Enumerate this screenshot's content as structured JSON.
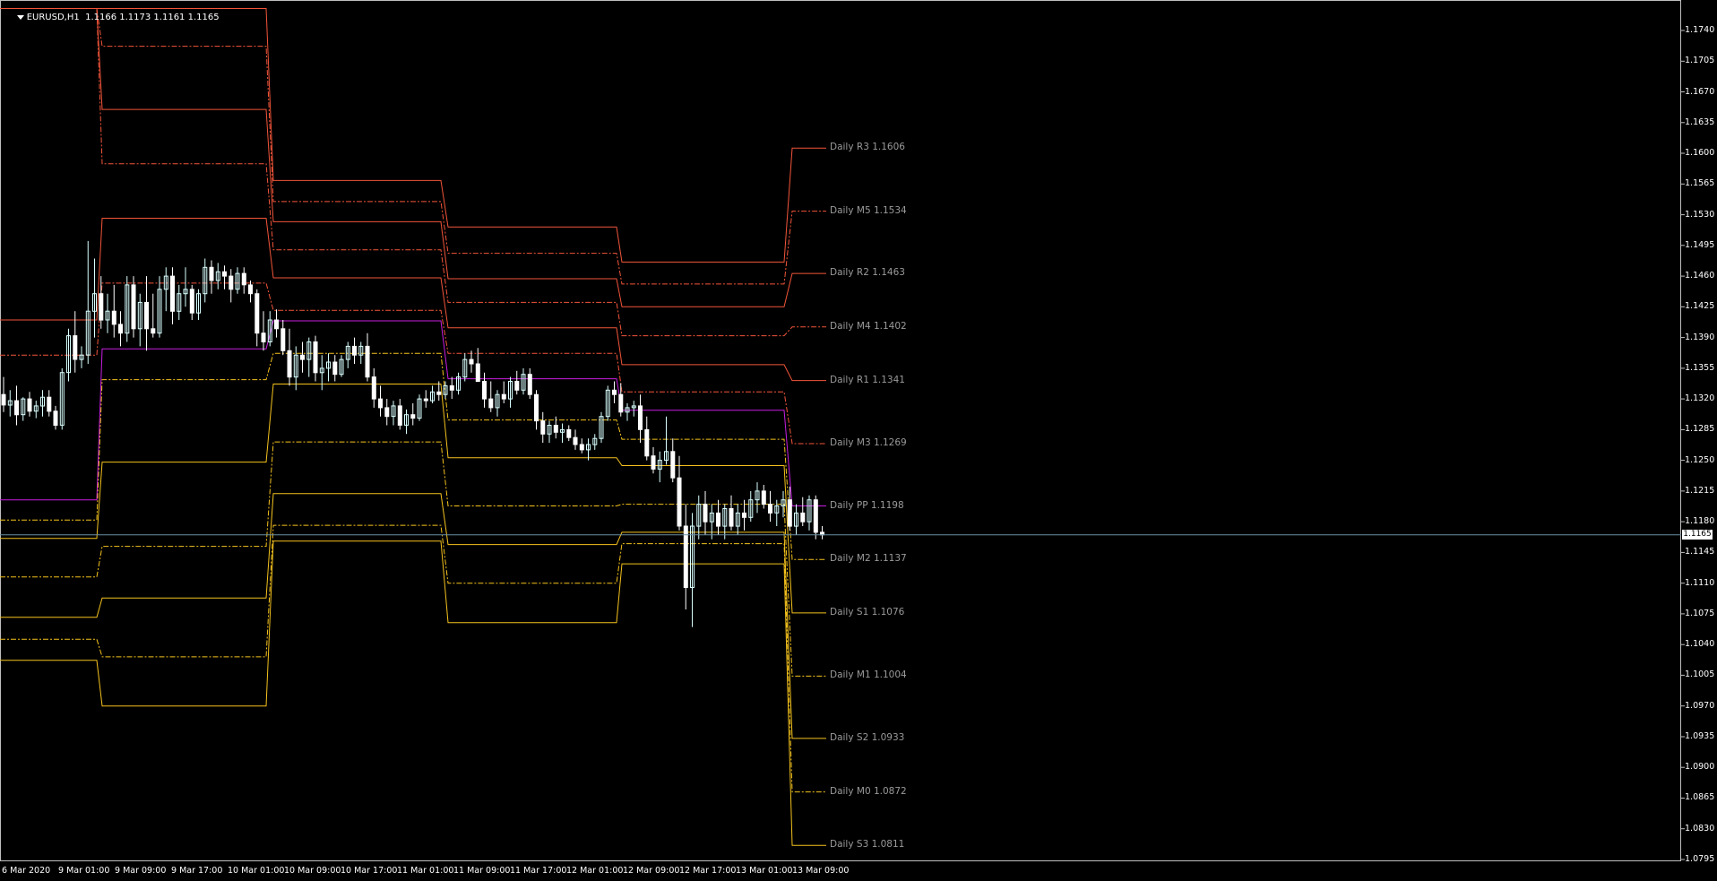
{
  "header": {
    "symbol": "EURUSD,H1",
    "ohlc": "1.1166 1.1173 1.1161 1.1165"
  },
  "current_price": "1.1165",
  "colors": {
    "background": "#000000",
    "resistance": "#f2553a",
    "support": "#f4c21d",
    "pivot": "#c81ee0",
    "candle_up": "#d9ffff",
    "candle_down": "#ffffff",
    "price_line": "#6b8fa3",
    "label": "#9a9a9a"
  },
  "y_ticks": [
    "1.1740",
    "1.1705",
    "1.1670",
    "1.1635",
    "1.1600",
    "1.1565",
    "1.1530",
    "1.1495",
    "1.1460",
    "1.1425",
    "1.1390",
    "1.1355",
    "1.1320",
    "1.1285",
    "1.1250",
    "1.1215",
    "1.1180",
    "1.1145",
    "1.1110",
    "1.1075",
    "1.1040",
    "1.1005",
    "1.0970",
    "1.0935",
    "1.0900",
    "1.0865",
    "1.0830",
    "1.0795"
  ],
  "x_ticks": [
    "6 Mar 2020",
    "9 Mar 01:00",
    "9 Mar 09:00",
    "9 Mar 17:00",
    "10 Mar 01:00",
    "10 Mar 09:00",
    "10 Mar 17:00",
    "11 Mar 01:00",
    "11 Mar 09:00",
    "11 Mar 17:00",
    "12 Mar 01:00",
    "12 Mar 09:00",
    "12 Mar 17:00",
    "13 Mar 01:00",
    "13 Mar 09:00"
  ],
  "chart_data": {
    "type": "candlestick",
    "title": "EURUSD,H1",
    "ylim": [
      1.0795,
      1.1765
    ],
    "pivot_levels": [
      {
        "name": "R3",
        "label": "Daily R3 1.1606",
        "kind": "resistance",
        "style": "solid",
        "values": [
          1.1765,
          1.1765,
          1.1569,
          1.1516,
          1.1476,
          1.1606
        ]
      },
      {
        "name": "M5",
        "label": "Daily M5 1.1534",
        "kind": "resistance",
        "style": "dashed",
        "values": [
          1.1765,
          1.1722,
          1.1545,
          1.1486,
          1.1451,
          1.1534
        ]
      },
      {
        "name": "R2",
        "label": "Daily R2 1.1463",
        "kind": "resistance",
        "style": "solid",
        "values": [
          1.1765,
          1.165,
          1.1522,
          1.1457,
          1.1425,
          1.1463
        ]
      },
      {
        "name": "M4",
        "label": "Daily M4 1.1402",
        "kind": "resistance",
        "style": "dashed",
        "values": [
          1.1765,
          1.1588,
          1.149,
          1.143,
          1.1392,
          1.1402
        ]
      },
      {
        "name": "R1",
        "label": "Daily R1 1.1341",
        "kind": "resistance",
        "style": "solid",
        "values": [
          1.141,
          1.1526,
          1.1458,
          1.1401,
          1.1359,
          1.1341
        ]
      },
      {
        "name": "M3",
        "label": "Daily M3 1.1269",
        "kind": "resistance",
        "style": "dashed",
        "values": [
          1.137,
          1.1452,
          1.1421,
          1.1372,
          1.1328,
          1.1269
        ]
      },
      {
        "name": "PP",
        "label": "Daily PP 1.1198",
        "kind": "pivot",
        "style": "solid",
        "values": [
          1.1205,
          1.1377,
          1.1409,
          1.1343,
          1.1307,
          1.1198
        ]
      },
      {
        "name": "M2",
        "label": "Daily M2 1.1137",
        "kind": "support",
        "style": "dashed",
        "values": [
          1.1182,
          1.1342,
          1.1372,
          1.1296,
          1.1274,
          1.1137
        ]
      },
      {
        "name": "S1",
        "label": "Daily S1 1.1076",
        "kind": "support",
        "style": "solid",
        "values": [
          1.1161,
          1.1248,
          1.1337,
          1.1253,
          1.1244,
          1.1076
        ]
      },
      {
        "name": "M1",
        "label": "Daily M1 1.1004",
        "kind": "support",
        "style": "dashed",
        "values": [
          1.1117,
          1.1152,
          1.1271,
          1.1198,
          1.12,
          1.1004
        ]
      },
      {
        "name": "S2",
        "label": "Daily S2 1.0933",
        "kind": "support",
        "style": "solid",
        "values": [
          1.1071,
          1.1093,
          1.1212,
          1.1154,
          1.1168,
          1.0933
        ]
      },
      {
        "name": "M0",
        "label": "Daily M0 1.0872",
        "kind": "support",
        "style": "dashed",
        "values": [
          1.1046,
          1.1026,
          1.1176,
          1.111,
          1.1155,
          1.0872
        ]
      },
      {
        "name": "S3",
        "label": "Daily S3 1.0811",
        "kind": "support",
        "style": "solid",
        "values": [
          1.1022,
          1.097,
          1.1158,
          1.1065,
          1.1132,
          1.0811
        ]
      }
    ],
    "candles": [
      [
        1.1325,
        1.1345,
        1.1305,
        1.1313
      ],
      [
        1.1313,
        1.133,
        1.13,
        1.1318
      ],
      [
        1.1318,
        1.1335,
        1.129,
        1.1302
      ],
      [
        1.1302,
        1.1322,
        1.1295,
        1.132
      ],
      [
        1.132,
        1.1328,
        1.13,
        1.1306
      ],
      [
        1.1306,
        1.1318,
        1.1298,
        1.1312
      ],
      [
        1.1312,
        1.133,
        1.13,
        1.1322
      ],
      [
        1.1322,
        1.133,
        1.13,
        1.1306
      ],
      [
        1.1306,
        1.1312,
        1.1285,
        1.129
      ],
      [
        1.129,
        1.1355,
        1.1285,
        1.135
      ],
      [
        1.135,
        1.14,
        1.134,
        1.1392
      ],
      [
        1.1392,
        1.142,
        1.135,
        1.1365
      ],
      [
        1.1365,
        1.138,
        1.1355,
        1.137
      ],
      [
        1.137,
        1.15,
        1.136,
        1.142
      ],
      [
        1.142,
        1.148,
        1.139,
        1.144
      ],
      [
        1.144,
        1.146,
        1.14,
        1.141
      ],
      [
        1.141,
        1.144,
        1.1395,
        1.142
      ],
      [
        1.142,
        1.145,
        1.139,
        1.1405
      ],
      [
        1.1405,
        1.142,
        1.138,
        1.1395
      ],
      [
        1.1395,
        1.146,
        1.1385,
        1.145
      ],
      [
        1.145,
        1.146,
        1.139,
        1.14
      ],
      [
        1.14,
        1.144,
        1.138,
        1.143
      ],
      [
        1.143,
        1.146,
        1.1375,
        1.14
      ],
      [
        1.14,
        1.144,
        1.139,
        1.1395
      ],
      [
        1.1395,
        1.146,
        1.139,
        1.1445
      ],
      [
        1.1445,
        1.147,
        1.142,
        1.146
      ],
      [
        1.146,
        1.147,
        1.1405,
        1.142
      ],
      [
        1.142,
        1.145,
        1.141,
        1.144
      ],
      [
        1.144,
        1.147,
        1.1425,
        1.1445
      ],
      [
        1.1445,
        1.145,
        1.141,
        1.1418
      ],
      [
        1.1418,
        1.1445,
        1.141,
        1.144
      ],
      [
        1.144,
        1.148,
        1.143,
        1.147
      ],
      [
        1.147,
        1.1478,
        1.144,
        1.1455
      ],
      [
        1.1455,
        1.1475,
        1.1445,
        1.1465
      ],
      [
        1.1465,
        1.1472,
        1.1445,
        1.146
      ],
      [
        1.146,
        1.1468,
        1.143,
        1.1445
      ],
      [
        1.1445,
        1.147,
        1.144,
        1.1463
      ],
      [
        1.1463,
        1.147,
        1.144,
        1.145
      ],
      [
        1.145,
        1.1455,
        1.143,
        1.144
      ],
      [
        1.144,
        1.1445,
        1.138,
        1.1395
      ],
      [
        1.1395,
        1.142,
        1.1375,
        1.1385
      ],
      [
        1.1385,
        1.142,
        1.138,
        1.141
      ],
      [
        1.141,
        1.1422,
        1.139,
        1.14
      ],
      [
        1.14,
        1.141,
        1.137,
        1.1375
      ],
      [
        1.1375,
        1.14,
        1.1335,
        1.1345
      ],
      [
        1.1345,
        1.138,
        1.133,
        1.137
      ],
      [
        1.137,
        1.1385,
        1.135,
        1.1365
      ],
      [
        1.1365,
        1.139,
        1.1345,
        1.1385
      ],
      [
        1.1385,
        1.1392,
        1.134,
        1.135
      ],
      [
        1.135,
        1.137,
        1.133,
        1.1355
      ],
      [
        1.1355,
        1.1372,
        1.134,
        1.1362
      ],
      [
        1.1362,
        1.137,
        1.134,
        1.1348
      ],
      [
        1.1348,
        1.137,
        1.1345,
        1.1365
      ],
      [
        1.1365,
        1.1385,
        1.1355,
        1.138
      ],
      [
        1.138,
        1.139,
        1.136,
        1.137
      ],
      [
        1.137,
        1.1385,
        1.136,
        1.138
      ],
      [
        1.138,
        1.1395,
        1.134,
        1.1345
      ],
      [
        1.1345,
        1.1355,
        1.131,
        1.132
      ],
      [
        1.132,
        1.1335,
        1.13,
        1.131
      ],
      [
        1.131,
        1.132,
        1.129,
        1.13
      ],
      [
        1.13,
        1.1318,
        1.129,
        1.1312
      ],
      [
        1.1312,
        1.132,
        1.1285,
        1.129
      ],
      [
        1.129,
        1.1308,
        1.128,
        1.1302
      ],
      [
        1.1302,
        1.1315,
        1.129,
        1.1298
      ],
      [
        1.1298,
        1.1325,
        1.1295,
        1.132
      ],
      [
        1.132,
        1.133,
        1.131,
        1.1318
      ],
      [
        1.1318,
        1.1335,
        1.1315,
        1.1328
      ],
      [
        1.1328,
        1.134,
        1.1318,
        1.1325
      ],
      [
        1.1325,
        1.134,
        1.132,
        1.1335
      ],
      [
        1.1335,
        1.1345,
        1.132,
        1.133
      ],
      [
        1.133,
        1.135,
        1.1325,
        1.1345
      ],
      [
        1.1345,
        1.1372,
        1.134,
        1.1365
      ],
      [
        1.1365,
        1.1375,
        1.135,
        1.136
      ],
      [
        1.136,
        1.1378,
        1.1355,
        1.134
      ],
      [
        1.134,
        1.135,
        1.131,
        1.132
      ],
      [
        1.132,
        1.134,
        1.1305,
        1.131
      ],
      [
        1.131,
        1.133,
        1.13,
        1.1325
      ],
      [
        1.1325,
        1.134,
        1.1315,
        1.132
      ],
      [
        1.132,
        1.1345,
        1.131,
        1.134
      ],
      [
        1.134,
        1.1352,
        1.1325,
        1.133
      ],
      [
        1.133,
        1.1355,
        1.1325,
        1.1348
      ],
      [
        1.1348,
        1.1355,
        1.132,
        1.1325
      ],
      [
        1.1325,
        1.133,
        1.1285,
        1.1295
      ],
      [
        1.1295,
        1.1305,
        1.127,
        1.128
      ],
      [
        1.128,
        1.1295,
        1.127,
        1.129
      ],
      [
        1.129,
        1.13,
        1.1275,
        1.1282
      ],
      [
        1.1282,
        1.1292,
        1.127,
        1.1285
      ],
      [
        1.1285,
        1.129,
        1.1272,
        1.1276
      ],
      [
        1.1276,
        1.1285,
        1.1262,
        1.1268
      ],
      [
        1.1268,
        1.1275,
        1.1258,
        1.1262
      ],
      [
        1.1262,
        1.1275,
        1.125,
        1.1268
      ],
      [
        1.1268,
        1.128,
        1.1262,
        1.1275
      ],
      [
        1.1275,
        1.1305,
        1.127,
        1.13
      ],
      [
        1.13,
        1.1335,
        1.1295,
        1.133
      ],
      [
        1.133,
        1.134,
        1.1315,
        1.1325
      ],
      [
        1.1325,
        1.1338,
        1.13,
        1.1305
      ],
      [
        1.1305,
        1.1315,
        1.1295,
        1.131
      ],
      [
        1.131,
        1.1318,
        1.13,
        1.1312
      ],
      [
        1.1312,
        1.1325,
        1.127,
        1.1285
      ],
      [
        1.1285,
        1.13,
        1.125,
        1.1255
      ],
      [
        1.1255,
        1.1265,
        1.1235,
        1.124
      ],
      [
        1.124,
        1.126,
        1.1225,
        1.125
      ],
      [
        1.125,
        1.13,
        1.1245,
        1.126
      ],
      [
        1.126,
        1.1275,
        1.1225,
        1.123
      ],
      [
        1.123,
        1.1255,
        1.117,
        1.1175
      ],
      [
        1.1175,
        1.12,
        1.108,
        1.1105
      ],
      [
        1.1105,
        1.119,
        1.106,
        1.1175
      ],
      [
        1.1175,
        1.121,
        1.116,
        1.12
      ],
      [
        1.12,
        1.1215,
        1.1165,
        1.118
      ],
      [
        1.118,
        1.12,
        1.116,
        1.119
      ],
      [
        1.119,
        1.1205,
        1.1165,
        1.1175
      ],
      [
        1.1175,
        1.12,
        1.116,
        1.1195
      ],
      [
        1.1195,
        1.121,
        1.117,
        1.1175
      ],
      [
        1.1175,
        1.12,
        1.1165,
        1.119
      ],
      [
        1.119,
        1.1205,
        1.117,
        1.1185
      ],
      [
        1.1185,
        1.1215,
        1.118,
        1.1205
      ],
      [
        1.1205,
        1.1225,
        1.119,
        1.1215
      ],
      [
        1.1215,
        1.1222,
        1.1195,
        1.12
      ],
      [
        1.12,
        1.1215,
        1.118,
        1.119
      ],
      [
        1.119,
        1.1205,
        1.1175,
        1.1198
      ],
      [
        1.1198,
        1.1215,
        1.1185,
        1.1205
      ],
      [
        1.1205,
        1.122,
        1.117,
        1.1175
      ],
      [
        1.1175,
        1.12,
        1.1165,
        1.119
      ],
      [
        1.119,
        1.1208,
        1.1175,
        1.118
      ],
      [
        1.118,
        1.121,
        1.117,
        1.1205
      ],
      [
        1.1205,
        1.121,
        1.116,
        1.1168
      ],
      [
        1.1168,
        1.1175,
        1.116,
        1.1165
      ]
    ]
  }
}
